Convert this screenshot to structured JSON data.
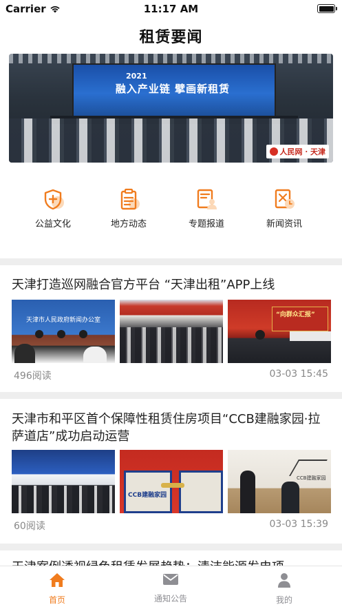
{
  "status_bar": {
    "carrier": "Carrier",
    "time": "11:17 AM"
  },
  "header": {
    "title": "租赁要闻"
  },
  "banner": {
    "year": "2021",
    "slogan": "融入产业链  擘画新租赁",
    "source_logo": "人民网 · 天津"
  },
  "quick_links": [
    {
      "label": "公益文化",
      "icon": "shield-plus-icon"
    },
    {
      "label": "地方动态",
      "icon": "clipboard-icon"
    },
    {
      "label": "专题报道",
      "icon": "report-person-icon"
    },
    {
      "label": "新闻资讯",
      "icon": "news-clock-icon"
    }
  ],
  "articles": [
    {
      "title": "天津打造巡网融合官方平台 “天津出租”APP上线",
      "reads": "496阅读",
      "date": "03-03 15:45"
    },
    {
      "title": "天津市和平区首个保障性租赁住房项目“CCB建融家园·拉萨道店”成功启动运营",
      "reads": "60阅读",
      "date": "03-03 15:39"
    },
    {
      "title": "天津案例透视绿色租赁发展趋势：清洁能源发电项"
    }
  ],
  "thumb_captions": {
    "a1_t1": "天津市人民政府新闻办公室",
    "a1_t3": "“向群众汇报”",
    "a2_t2": "CCB建融家园",
    "a2_t3": "CCB建融家园"
  },
  "tabs": [
    {
      "label": "首页",
      "icon": "home-icon",
      "active": true
    },
    {
      "label": "通知公告",
      "icon": "mail-icon",
      "active": false
    },
    {
      "label": "我的",
      "icon": "person-icon",
      "active": false
    }
  ],
  "colors": {
    "accent": "#f07c1e",
    "icon_light": "#fcd9b8",
    "inactive": "#8e8e93",
    "divider": "#eeeeee"
  }
}
